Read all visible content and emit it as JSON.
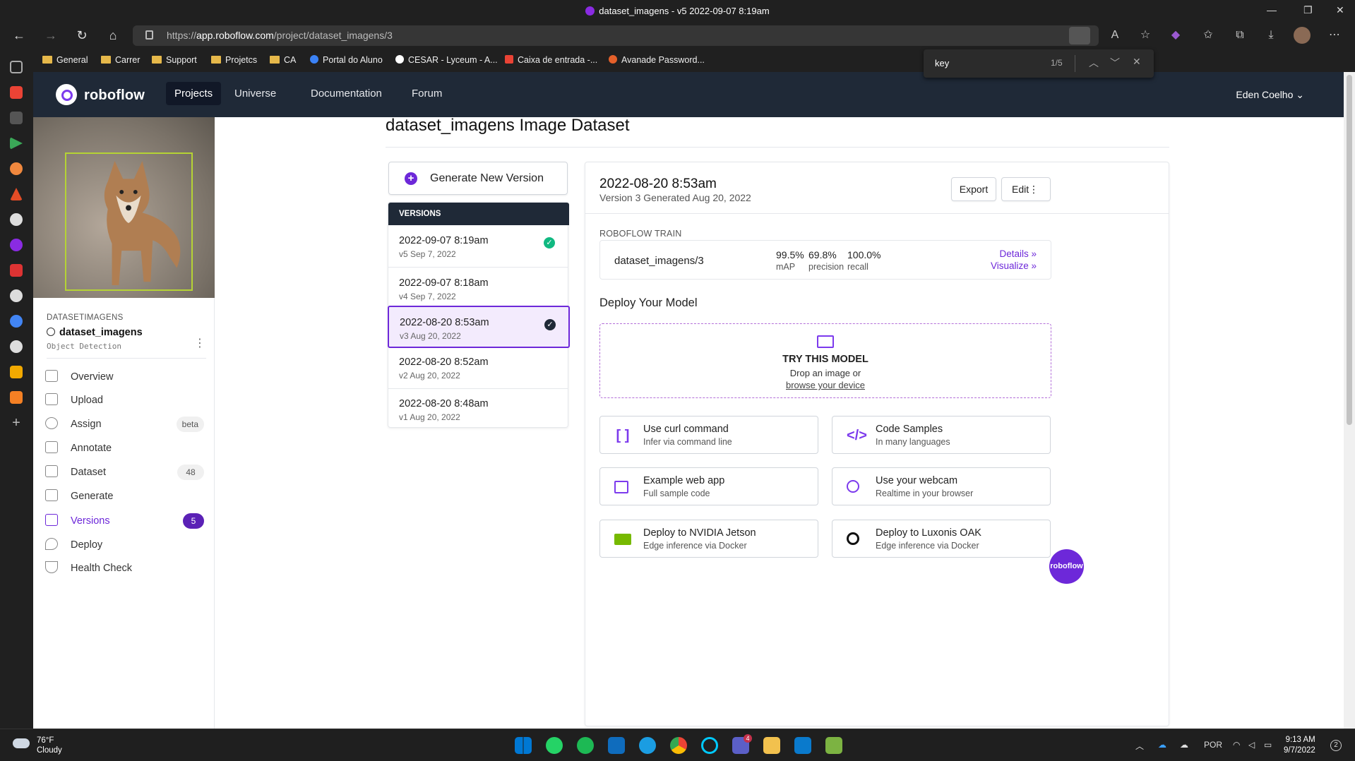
{
  "window": {
    "title": "dataset_imagens - v5 2022-09-07 8:19am"
  },
  "browser": {
    "url_prefix": "https://",
    "url_domain": "app.roboflow.com",
    "url_path": "/project/dataset_imagens/3",
    "bookmarks": [
      "General",
      "Carrer",
      "Support",
      "Projetcs",
      "CA",
      "Portal do Aluno",
      "CESAR - Lyceum - A...",
      "Caixa de entrada -...",
      "Avanade Password..."
    ],
    "find": {
      "query": "key",
      "count": "1/5"
    }
  },
  "topnav": {
    "brand": "roboflow",
    "links": [
      "Projects",
      "Universe",
      "Documentation",
      "Forum"
    ],
    "user": "Eden Coelho"
  },
  "project": {
    "label": "DATASETIMAGENS",
    "name": "dataset_imagens",
    "type": "Object Detection"
  },
  "menu": [
    {
      "label": "Overview",
      "icon": "overview-icon",
      "badge": ""
    },
    {
      "label": "Upload",
      "icon": "upload-icon",
      "badge": ""
    },
    {
      "label": "Assign",
      "icon": "assign-icon",
      "badge": "beta"
    },
    {
      "label": "Annotate",
      "icon": "annotate-icon",
      "badge": ""
    },
    {
      "label": "Dataset",
      "icon": "dataset-icon",
      "badge": "48"
    },
    {
      "label": "Generate",
      "icon": "generate-icon",
      "badge": ""
    },
    {
      "label": "Versions",
      "icon": "versions-icon",
      "badge": "5"
    },
    {
      "label": "Deploy",
      "icon": "deploy-icon",
      "badge": ""
    },
    {
      "label": "Health Check",
      "icon": "health-check-icon",
      "badge": ""
    }
  ],
  "page": {
    "title": "dataset_imagens Image Dataset",
    "generate_label": "Generate New Version",
    "versions_header": "VERSIONS"
  },
  "versions": [
    {
      "date": "2022-09-07 8:19am",
      "sub": "v5 Sep 7, 2022",
      "status": "check-green"
    },
    {
      "date": "2022-09-07 8:18am",
      "sub": "v4 Sep 7, 2022",
      "status": ""
    },
    {
      "date": "2022-08-20 8:53am",
      "sub": "v3 Aug 20, 2022",
      "status": "check-dark"
    },
    {
      "date": "2022-08-20 8:52am",
      "sub": "v2 Aug 20, 2022",
      "status": ""
    },
    {
      "date": "2022-08-20 8:48am",
      "sub": "v1 Aug 20, 2022",
      "status": ""
    }
  ],
  "detail": {
    "title": "2022-08-20 8:53am",
    "subtitle": "Version 3 Generated Aug 20, 2022",
    "export_label": "Export",
    "edit_label": "Edit",
    "train_header": "ROBOFLOW TRAIN",
    "model_name": "dataset_imagens/3",
    "metrics": [
      {
        "value": "99.5%",
        "label": "mAP"
      },
      {
        "value": "69.8%",
        "label": "precision"
      },
      {
        "value": "100.0%",
        "label": "recall"
      }
    ],
    "details_link": "Details »",
    "visualize_link": "Visualize »",
    "deploy_heading": "Deploy Your Model",
    "try_title": "TRY THIS MODEL",
    "try_drop": "Drop an image or",
    "try_browse": "browse your device",
    "options": [
      {
        "title": "Use curl command",
        "sub": "Infer via command line",
        "icon": "brackets-icon"
      },
      {
        "title": "Code Samples",
        "sub": "In many languages",
        "icon": "code-icon"
      },
      {
        "title": "Example web app",
        "sub": "Full sample code",
        "icon": "browser-window-icon"
      },
      {
        "title": "Use your webcam",
        "sub": "Realtime in your browser",
        "icon": "webcam-icon"
      },
      {
        "title": "Deploy to NVIDIA Jetson",
        "sub": "Edge inference via Docker",
        "icon": "nvidia-icon"
      },
      {
        "title": "Deploy to Luxonis OAK",
        "sub": "Edge inference via Docker",
        "icon": "luxonis-icon"
      }
    ]
  },
  "fab_label": "roboflow",
  "taskbar": {
    "temp": "76°F",
    "condition": "Cloudy",
    "lang": "POR",
    "time": "9:13 AM",
    "date": "9/7/2022",
    "notif": "2",
    "teams_badge": "4"
  },
  "colors": {
    "accent": "#6d28d9",
    "nav": "#1f2937",
    "success": "#10b981"
  }
}
